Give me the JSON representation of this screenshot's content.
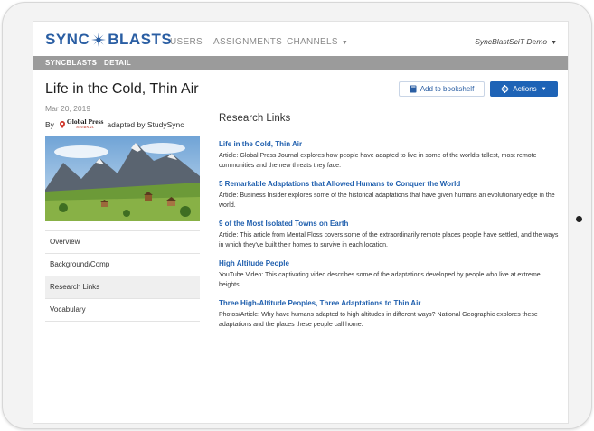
{
  "brand": {
    "logo_left": "SYNC",
    "logo_right": "BLASTS"
  },
  "nav": {
    "users": "USERS",
    "assignments": "ASSIGNMENTS",
    "channels": "CHANNELS",
    "user_menu": "SyncBlastSciT Demo"
  },
  "breadcrumb": {
    "root": "SYNCBLASTS",
    "separator": "›",
    "current": "DETAIL"
  },
  "article": {
    "title": "Life in the Cold, Thin Air",
    "date": "Mar 20, 2019",
    "by": "By",
    "publisher": "Global Press",
    "publisher_sub": "JOURNAL",
    "adapted": "adapted by StudySync"
  },
  "buttons": {
    "bookshelf": "Add to bookshelf",
    "actions": "Actions"
  },
  "sidebar": {
    "items": [
      {
        "label": "Overview"
      },
      {
        "label": "Background/Comp"
      },
      {
        "label": "Research Links"
      },
      {
        "label": "Vocabulary"
      }
    ]
  },
  "research": {
    "heading": "Research Links",
    "links": [
      {
        "title": "Life in the Cold, Thin Air",
        "desc": "Article: Global Press Journal explores how people have adapted to live in some of the world's tallest, most remote communities and the new threats they face."
      },
      {
        "title": "5 Remarkable Adaptations that Allowed Humans to Conquer the World",
        "desc": "Article: Business Insider explores some of the historical adaptations that have given humans an evolutionary edge in the world."
      },
      {
        "title": "9 of the Most Isolated Towns on Earth",
        "desc": "Article: This article from Mental Floss covers some of the extraordinarily remote places people have settled, and the ways in which they've built their homes to survive in each location."
      },
      {
        "title": "High Altitude People",
        "desc": "YouTube Video: This captivating video describes some of the adaptations developed by people who live at extreme heights."
      },
      {
        "title": "Three High-Altitude Peoples, Three Adaptations to Thin Air",
        "desc": "Photos/Article: Why have humans adapted to high altitudes in different ways? National Geographic explores these adaptations and the places these people call home."
      }
    ]
  },
  "colors": {
    "brand_blue": "#2a5ea3",
    "link_blue": "#1f5fae",
    "action_blue": "#1e63b6",
    "crumb_gray": "#9b9b9b"
  }
}
